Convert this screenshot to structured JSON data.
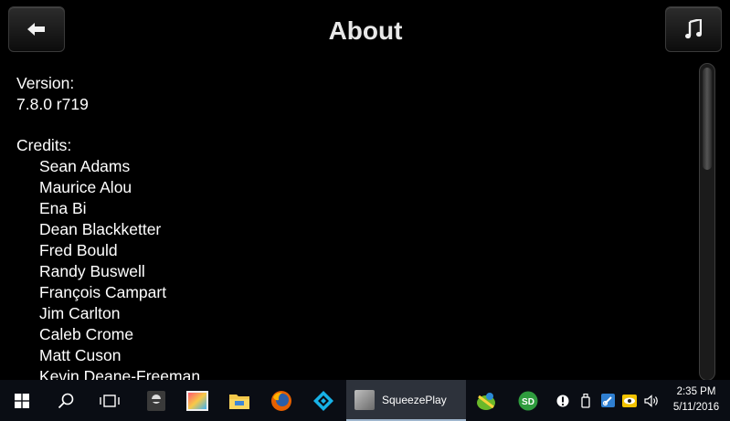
{
  "header": {
    "title": "About",
    "back_icon": "back-arrow-icon",
    "now_playing_icon": "music-note-icon"
  },
  "content": {
    "version_label": "Version:",
    "version_value": "7.8.0 r719",
    "credits_label": "Credits:",
    "credits": [
      "Sean Adams",
      "Maurice Alou",
      "Ena Bi",
      "Dean Blackketter",
      "Fred Bould",
      "Randy Buswell",
      "François Campart",
      "Jim Carlton",
      "Caleb Crome",
      "Matt Cuson",
      "Kevin Deane-Freeman"
    ]
  },
  "taskbar": {
    "active_app_label": "SqueezePlay",
    "clock_time": "2:35 PM",
    "clock_date": "5/11/2016",
    "icons": [
      "windows-start-icon",
      "search-icon",
      "task-view-icon",
      "app-icon",
      "paint-icon",
      "file-explorer-icon",
      "firefox-icon",
      "kodi-icon",
      "squeezeplay-icon",
      "pinned-app-icon",
      "sd-icon",
      "tray-info-icon",
      "usb-icon",
      "network-icon",
      "eye-icon",
      "volume-icon"
    ]
  }
}
